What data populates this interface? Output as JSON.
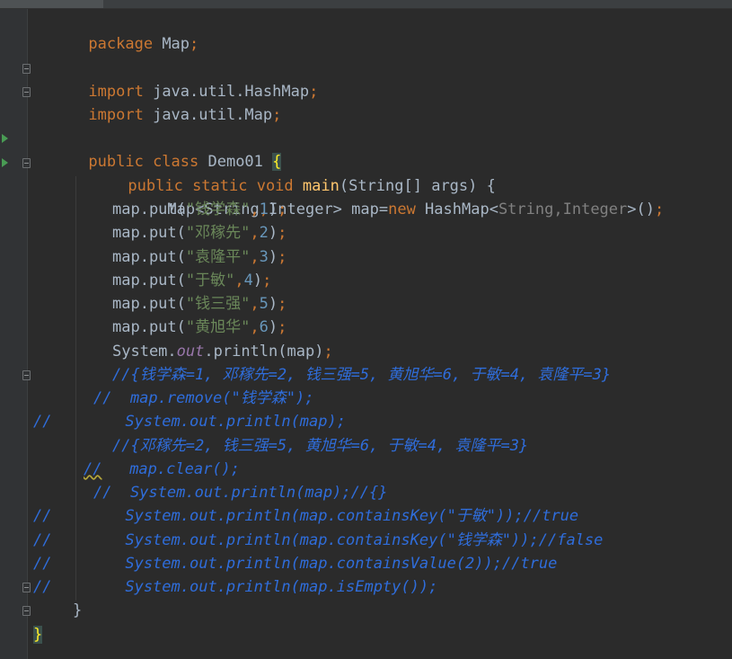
{
  "editor": {
    "lines": {
      "l01": {
        "a": "package",
        "b": " Map",
        "c": ";"
      },
      "l03": {
        "a": "import",
        "b": " java.util.HashMap",
        "c": ";"
      },
      "l04": {
        "a": "import",
        "b": " java.util.Map",
        "c": ";"
      },
      "l06": {
        "a": "public class",
        "b": " Demo01 ",
        "c": "{"
      },
      "l07": {
        "a": "public static void",
        "b": " ",
        "c": "main",
        "d": "(String[] args) {"
      },
      "l08": {
        "a": "Map<String",
        "b": ",",
        "c": "Integer> map=",
        "d": "new",
        "e": " HashMap<",
        "f": "String",
        "g": ",",
        "h": "Integer",
        "i": ">()",
        "j": ";"
      },
      "put1": {
        "a": "map.put(",
        "b": "\"钱学森\"",
        "c": ",",
        "d": "1",
        "e": ")",
        "f": ";"
      },
      "put2": {
        "a": "map.put(",
        "b": "\"邓稼先\"",
        "c": ",",
        "d": "2",
        "e": ")",
        "f": ";"
      },
      "put3": {
        "a": "map.put(",
        "b": "\"袁隆平\"",
        "c": ",",
        "d": "3",
        "e": ")",
        "f": ";"
      },
      "put4": {
        "a": "map.put(",
        "b": "\"于敏\"",
        "c": ",",
        "d": "4",
        "e": ")",
        "f": ";"
      },
      "put5": {
        "a": "map.put(",
        "b": "\"钱三强\"",
        "c": ",",
        "d": "5",
        "e": ")",
        "f": ";"
      },
      "put6": {
        "a": "map.put(",
        "b": "\"黄旭华\"",
        "c": ",",
        "d": "6",
        "e": ")",
        "f": ";"
      },
      "l15": {
        "a": "System.",
        "b": "out",
        "c": ".println(map)",
        "d": ";"
      },
      "l16": {
        "a": "//{钱学森=1, 邓稼先=2, 钱三强=5, 黄旭华=6, 于敏=4, 袁隆平=3}"
      },
      "l17": {
        "a": "//  map.remove(\"钱学森\");"
      },
      "l18": {
        "a": "//        System.out.println(map);"
      },
      "l19": {
        "a": "//{邓稼先=2, 钱三强=5, 黄旭华=6, 于敏=4, 袁隆平=3}"
      },
      "l20": {
        "a": "//",
        "b": "   map.clear();"
      },
      "l21": {
        "a": "//  System.out.println(map);//{}"
      },
      "l22": {
        "a": "//        System.out.println(map.containsKey(\"于敏\"));//true"
      },
      "l23": {
        "a": "//        System.out.println(map.containsKey(\"钱学森\"));//false"
      },
      "l24": {
        "a": "//        System.out.println(map.containsValue(2));//true"
      },
      "l25": {
        "a": "//        System.out.println(map.isEmpty());"
      },
      "l26": {
        "a": "}"
      },
      "l27": {
        "a": "}"
      }
    }
  },
  "colors": {
    "background": "#2b2b2b",
    "gutter": "#313335",
    "keyword": "#cc7832",
    "text": "#a9b7c6",
    "string": "#6a8759",
    "number": "#6897bb",
    "comment": "#2f6ddb",
    "field": "#9876aa",
    "method": "#ffc66d",
    "run_icon": "#499c54"
  }
}
